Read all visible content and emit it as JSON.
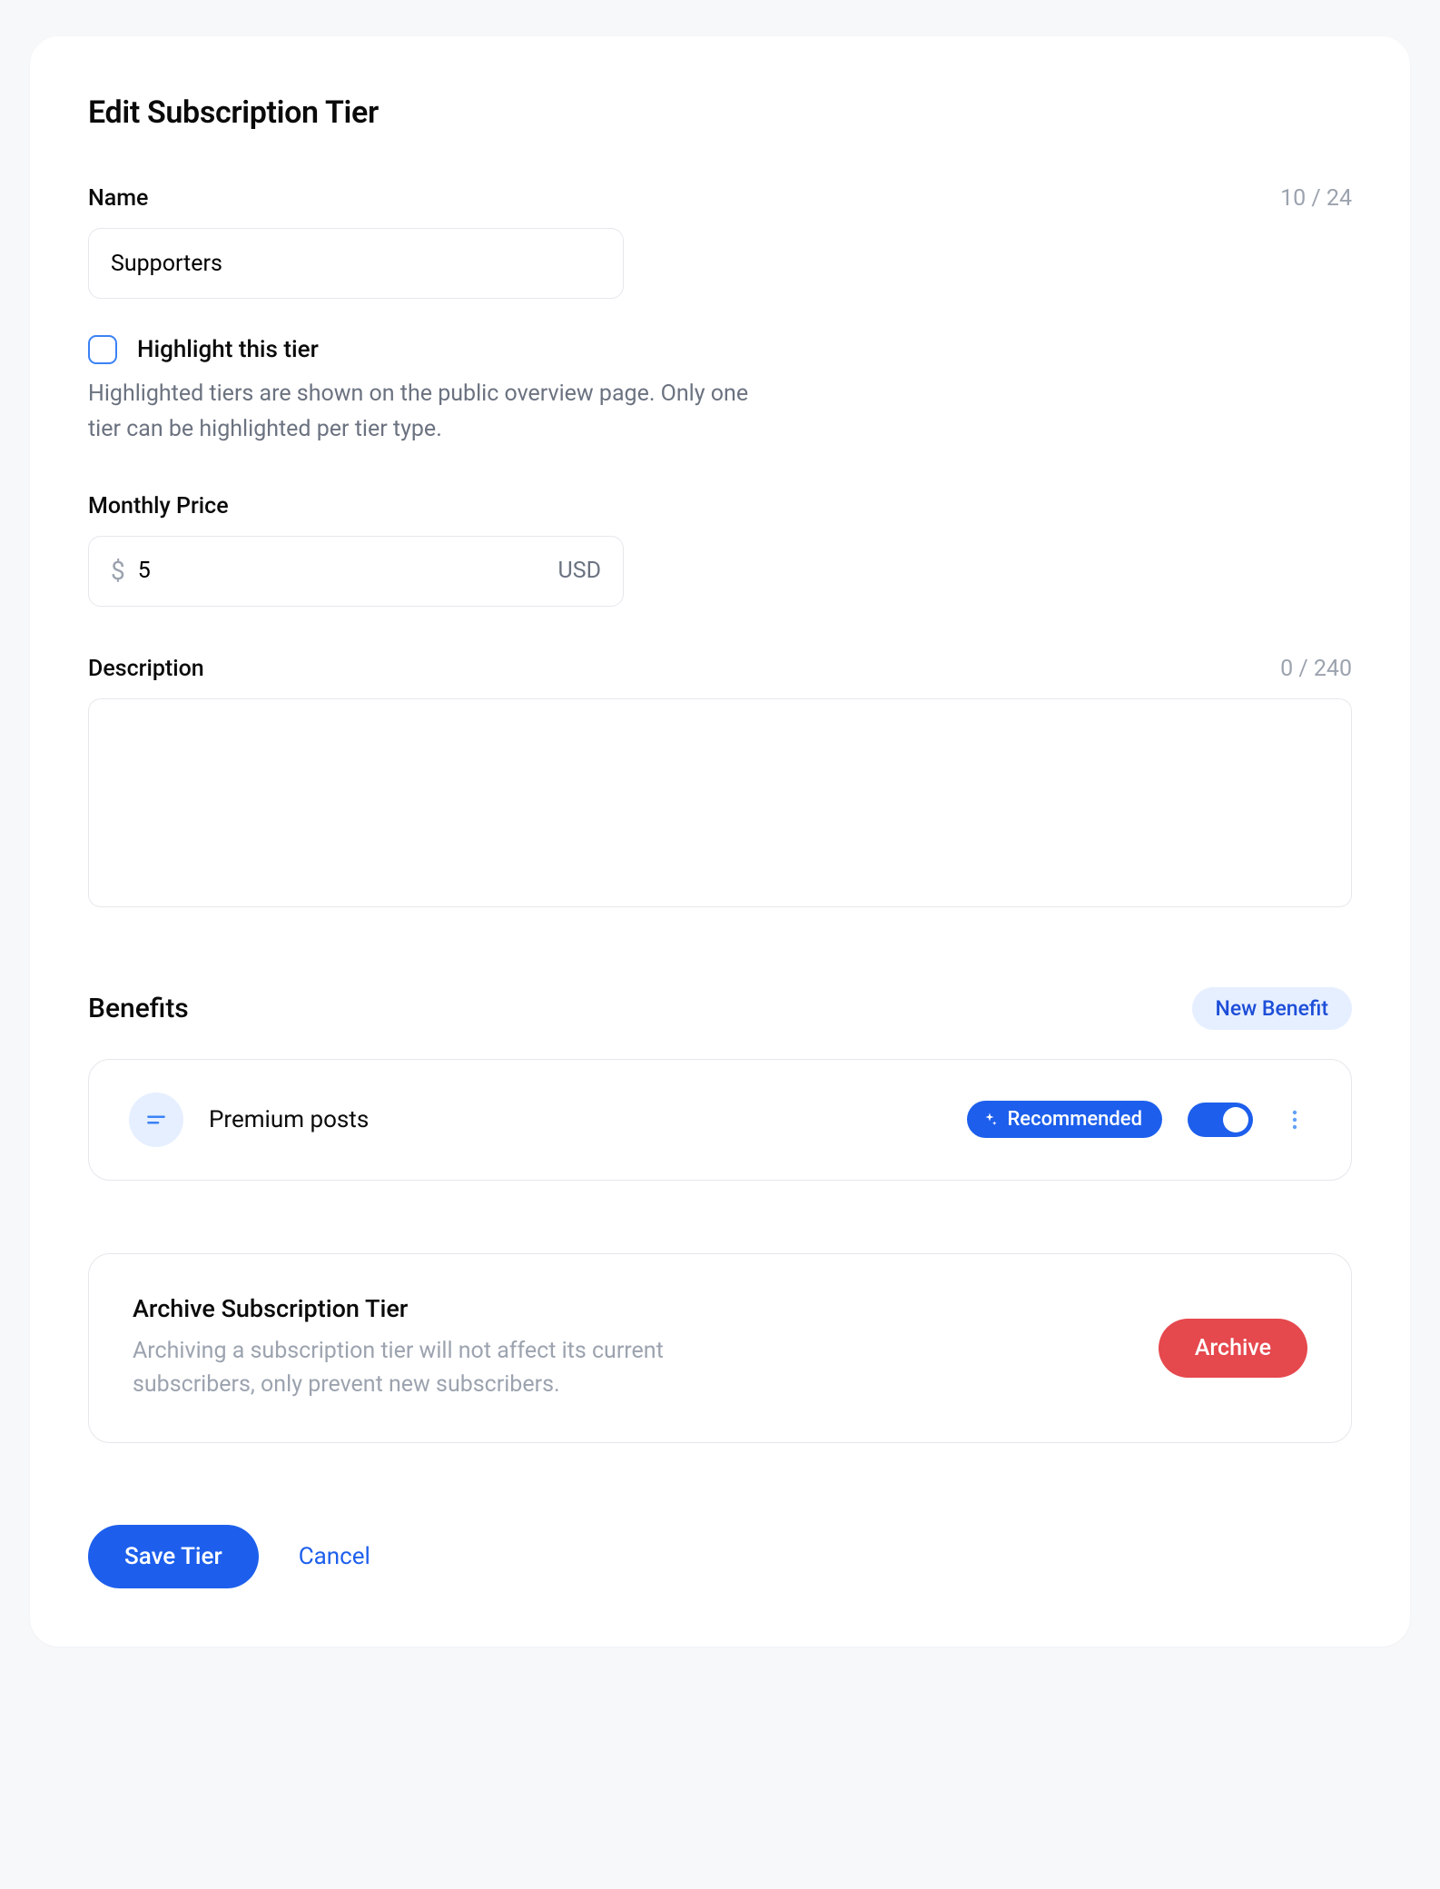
{
  "page": {
    "title": "Edit Subscription Tier"
  },
  "name_field": {
    "label": "Name",
    "value": "Supporters",
    "counter": "10 / 24"
  },
  "highlight": {
    "label": "Highlight this tier",
    "checked": false,
    "help": "Highlighted tiers are shown on the public overview page. Only one tier can be highlighted per tier type."
  },
  "price": {
    "label": "Monthly Price",
    "currency_symbol": "$",
    "value": "5",
    "currency_code": "USD"
  },
  "description": {
    "label": "Description",
    "value": "",
    "counter": "0 / 240"
  },
  "benefits": {
    "title": "Benefits",
    "new_button": "New Benefit",
    "items": [
      {
        "name": "Premium posts",
        "badge": "Recommended",
        "enabled": true
      }
    ]
  },
  "archive": {
    "title": "Archive Subscription Tier",
    "description": "Archiving a subscription tier will not affect its current subscribers, only prevent new subscribers.",
    "button": "Archive"
  },
  "actions": {
    "save": "Save Tier",
    "cancel": "Cancel"
  }
}
